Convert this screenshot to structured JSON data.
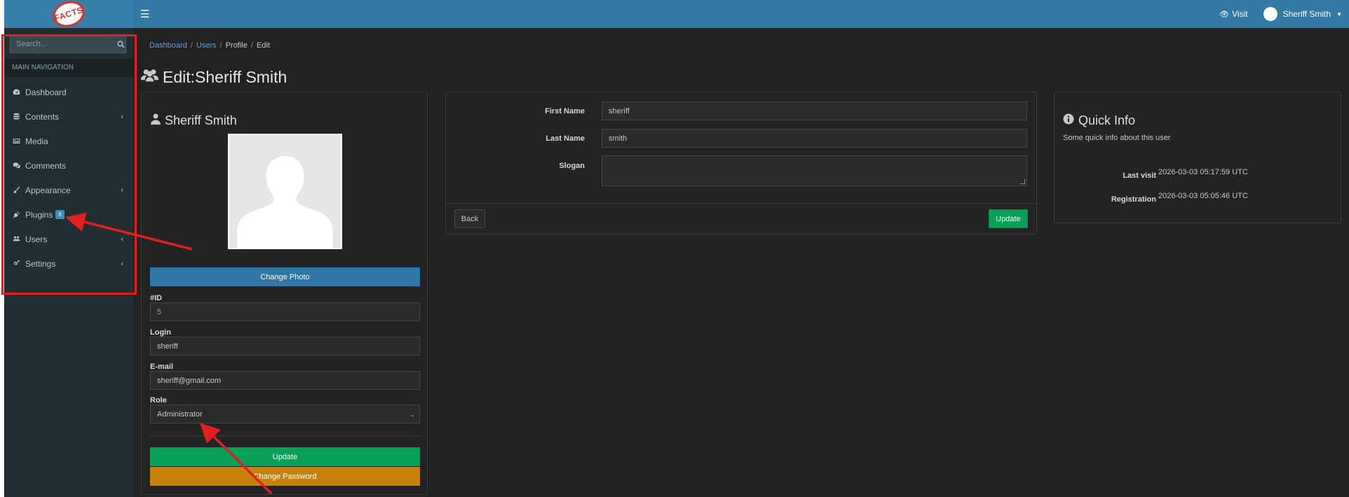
{
  "brand": {
    "logo_text": "FACTS"
  },
  "topbar": {
    "visit_label": "Visit",
    "user_name": "Sheriff Smith"
  },
  "sidebar": {
    "search_placeholder": "Search...",
    "header": "MAIN NAVIGATION",
    "items": [
      {
        "label": "Dashboard",
        "icon": "dashboard-icon",
        "has_submenu": false
      },
      {
        "label": "Contents",
        "icon": "database-icon",
        "has_submenu": true
      },
      {
        "label": "Media",
        "icon": "image-icon",
        "has_submenu": false
      },
      {
        "label": "Comments",
        "icon": "comments-icon",
        "has_submenu": false
      },
      {
        "label": "Appearance",
        "icon": "paint-brush-icon",
        "has_submenu": true
      },
      {
        "label": "Plugins",
        "icon": "plug-icon",
        "has_submenu": false,
        "badge": "6"
      },
      {
        "label": "Users",
        "icon": "users-icon",
        "has_submenu": true
      },
      {
        "label": "Settings",
        "icon": "gears-icon",
        "has_submenu": true
      }
    ]
  },
  "breadcrumb": {
    "items": [
      "Dashboard",
      "Users",
      "Profile",
      "Edit"
    ]
  },
  "page": {
    "title": "Edit:Sheriff Smith"
  },
  "profile": {
    "name": "Sheriff Smith",
    "change_photo_label": "Change Photo",
    "id_label": "#ID",
    "id_value": "5",
    "login_label": "Login",
    "login_value": "sheriff",
    "email_label": "E-mail",
    "email_value": "sheriff@gmail.com",
    "role_label": "Role",
    "role_value": "Administrator",
    "update_label": "Update",
    "change_password_label": "Change Password"
  },
  "form": {
    "first_name_label": "First Name",
    "first_name_value": "sheriff",
    "last_name_label": "Last Name",
    "last_name_value": "smith",
    "slogan_label": "Slogan",
    "slogan_value": "",
    "back_label": "Back",
    "update_label": "Update"
  },
  "quick_info": {
    "title": "Quick Info",
    "subtitle": "Some quick info about this user",
    "last_visit_label": "Last visit",
    "last_visit_value": "2026-03-03 05:17:59 UTC",
    "registration_label": "Registration",
    "registration_value": "2026-03-03 05:05:46 UTC"
  },
  "colors": {
    "topbar": "#327aa3",
    "sidebar": "#222d32",
    "content_bg": "#222222",
    "primary_button": "#2f77a6",
    "success_button": "#08a056",
    "warning_button": "#c7820a",
    "annotation_red": "#e02020"
  }
}
